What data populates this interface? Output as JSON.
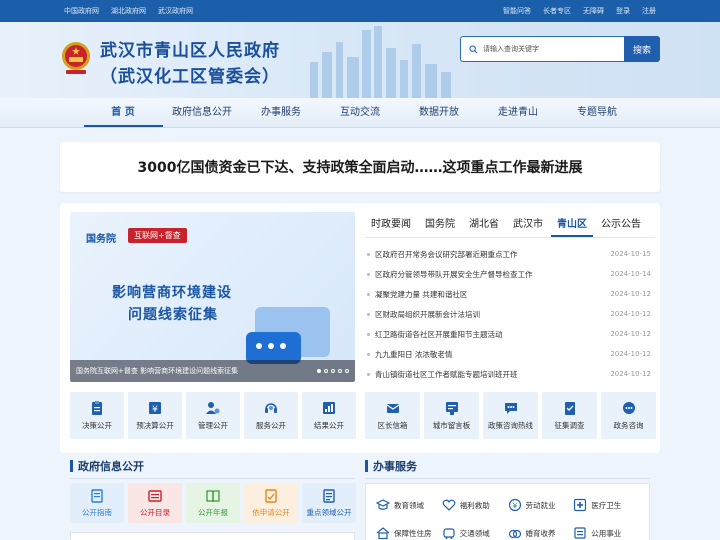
{
  "topbar": {
    "left_links": [
      "中国政府网",
      "湖北政府网",
      "武汉政府网"
    ],
    "right_links": [
      "智能问答",
      "长者专区",
      "无障碍",
      "登录",
      "注册"
    ]
  },
  "header": {
    "title_line1": "武汉市青山区人民政府",
    "title_line2": "（武汉化工区管委会）",
    "search_placeholder": "请输入查询关键字",
    "search_button": "搜索"
  },
  "nav": {
    "items": [
      "首 页",
      "政府信息公开",
      "办事服务",
      "互动交流",
      "数据开放",
      "走进青山",
      "专题导航"
    ],
    "active_index": 0
  },
  "headline": "3000亿国债资金已下达、支持政策全面启动……这项重点工作最新进展",
  "slide": {
    "brand": "国务院",
    "tag": "互联网+督查",
    "main_line1": "影响营商环境建设",
    "main_line2": "问题线索征集",
    "caption": "国务院互联网+督查 影响营商环境建设问题线索征集"
  },
  "news_tabs": {
    "items": [
      "时政要闻",
      "国务院",
      "湖北省",
      "武汉市",
      "青山区",
      "公示公告"
    ],
    "active_index": 4
  },
  "news": [
    {
      "title": "区政府召开常务会议研究部署近期重点工作",
      "date": "2024-10-15"
    },
    {
      "title": "区政府分管领导带队开展安全生产督导检查工作",
      "date": "2024-10-14"
    },
    {
      "title": "凝聚党建力量 共建和谐社区",
      "date": "2024-10-12"
    },
    {
      "title": "区财政局组织开展新会计法培训",
      "date": "2024-10-12"
    },
    {
      "title": "红卫路街道各社区开展重阳节主题活动",
      "date": "2024-10-12"
    },
    {
      "title": "九九重阳日 浓浓敬老情",
      "date": "2024-10-12"
    },
    {
      "title": "青山镇街道社区工作者赋能专题培训班开班",
      "date": "2024-10-12"
    }
  ],
  "quick_left": [
    {
      "label": "决策公开",
      "icon": "clipboard-icon"
    },
    {
      "label": "预决算公开",
      "icon": "budget-icon"
    },
    {
      "label": "管理公开",
      "icon": "user-gear-icon"
    },
    {
      "label": "服务公开",
      "icon": "headset-icon"
    },
    {
      "label": "结果公开",
      "icon": "chart-icon"
    }
  ],
  "quick_right": [
    {
      "label": "区长信箱",
      "icon": "mail-icon"
    },
    {
      "label": "城市留言板",
      "icon": "message-board-icon"
    },
    {
      "label": "政策咨询热线",
      "icon": "chat-icon"
    },
    {
      "label": "征集调查",
      "icon": "survey-icon"
    },
    {
      "label": "政务咨询",
      "icon": "consult-icon"
    }
  ],
  "sections": {
    "gov_info": "政府信息公开",
    "services": "办事服务"
  },
  "public_tiles": [
    {
      "label": "公开指南",
      "color": "#2a7fd4",
      "bg": "#e3eefb",
      "icon": "guide-icon"
    },
    {
      "label": "公开目录",
      "color": "#c8232c",
      "bg": "#fbe6e6",
      "icon": "catalog-icon"
    },
    {
      "label": "公开年报",
      "color": "#3a9a3a",
      "bg": "#e6f4e3",
      "icon": "report-icon"
    },
    {
      "label": "依申请公开",
      "color": "#e08a1e",
      "bg": "#fcefe0",
      "icon": "apply-icon"
    },
    {
      "label": "重点领域公开",
      "color": "#1f5fae",
      "bg": "#e3eefb",
      "icon": "key-area-icon"
    }
  ],
  "service_items": [
    {
      "label": "教育领域",
      "icon": "education-icon"
    },
    {
      "label": "福利救助",
      "icon": "welfare-icon"
    },
    {
      "label": "劳动就业",
      "icon": "employment-icon"
    },
    {
      "label": "医疗卫生",
      "icon": "medical-icon"
    },
    {
      "label": "保障性住房",
      "icon": "housing-icon"
    },
    {
      "label": "交通领域",
      "icon": "traffic-icon"
    },
    {
      "label": "婚育收养",
      "icon": "marriage-icon"
    },
    {
      "label": "公用事业",
      "icon": "utility-icon"
    }
  ]
}
